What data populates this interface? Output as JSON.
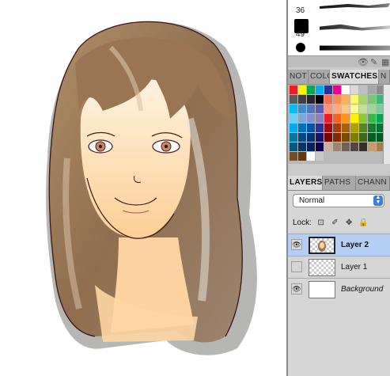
{
  "brushes": {
    "sizes": [
      "36",
      "49"
    ]
  },
  "swatches_panel": {
    "tabs": [
      "NOT",
      "COLO",
      "SWATCHES",
      "N"
    ],
    "active_tab": "SWATCHES",
    "colors": [
      "#ed1c24",
      "#fff200",
      "#00a651",
      "#00aeef",
      "#2e3192",
      "#ec008c",
      "#ffffff",
      "#d9d9d9",
      "#bfbfbf",
      "#a6a6a6",
      "#8c8c8c",
      "#737373",
      "#595959",
      "#404040",
      "#262626",
      "#000000",
      "#f26c4f",
      "#f68e56",
      "#fbaf5d",
      "#fff568",
      "#acd373",
      "#7cc576",
      "#3bb878",
      "#1abbb4",
      "#00bff3",
      "#438ccb",
      "#5674b9",
      "#605ca8",
      "#f69679",
      "#f9ad81",
      "#fdc68a",
      "#fff799",
      "#c4df9b",
      "#a3d39c",
      "#82ca9c",
      "#7accc8",
      "#6dcff6",
      "#7da7d9",
      "#8393ca",
      "#8781bd",
      "#ed1c24",
      "#f26522",
      "#f7941d",
      "#fff200",
      "#8dc63f",
      "#39b54a",
      "#00a651",
      "#00a99d",
      "#00aeef",
      "#0072bc",
      "#0054a6",
      "#2e3192",
      "#9e0b0f",
      "#a0410d",
      "#a3620a",
      "#aba000",
      "#598527",
      "#197b30",
      "#007236",
      "#00746b",
      "#0076a3",
      "#004a80",
      "#003471",
      "#1b1464",
      "#790000",
      "#7b2e00",
      "#7d4900",
      "#827b00",
      "#406618",
      "#005e20",
      "#005826",
      "#005952",
      "#005b7f",
      "#003663",
      "#002157",
      "#0d004c",
      "#c7b299",
      "#998675",
      "#736357",
      "#534741",
      "#362f2d",
      "#c69c6d",
      "#a67c52",
      "#8c6239",
      "#754c24",
      "#603913",
      "#ffffff",
      "#c8c8c8"
    ]
  },
  "layers_panel": {
    "tabs": [
      "LAYERS",
      "PATHS",
      "CHANN"
    ],
    "active_tab": "LAYERS",
    "blend_mode": "Normal",
    "lock_label": "Lock:",
    "layers": [
      {
        "name": "Layer 2",
        "visible": true,
        "selected": true
      },
      {
        "name": "Layer 1",
        "visible": false,
        "selected": false
      },
      {
        "name": "Background",
        "visible": true,
        "selected": false
      }
    ]
  },
  "icons": [
    "brush-visibility-icon",
    "brush-tool-icon",
    "eye-icon",
    "lock-transparency-icon",
    "lock-brush-icon",
    "lock-move-icon",
    "lock-all-icon",
    "blend-arrows-icon"
  ]
}
